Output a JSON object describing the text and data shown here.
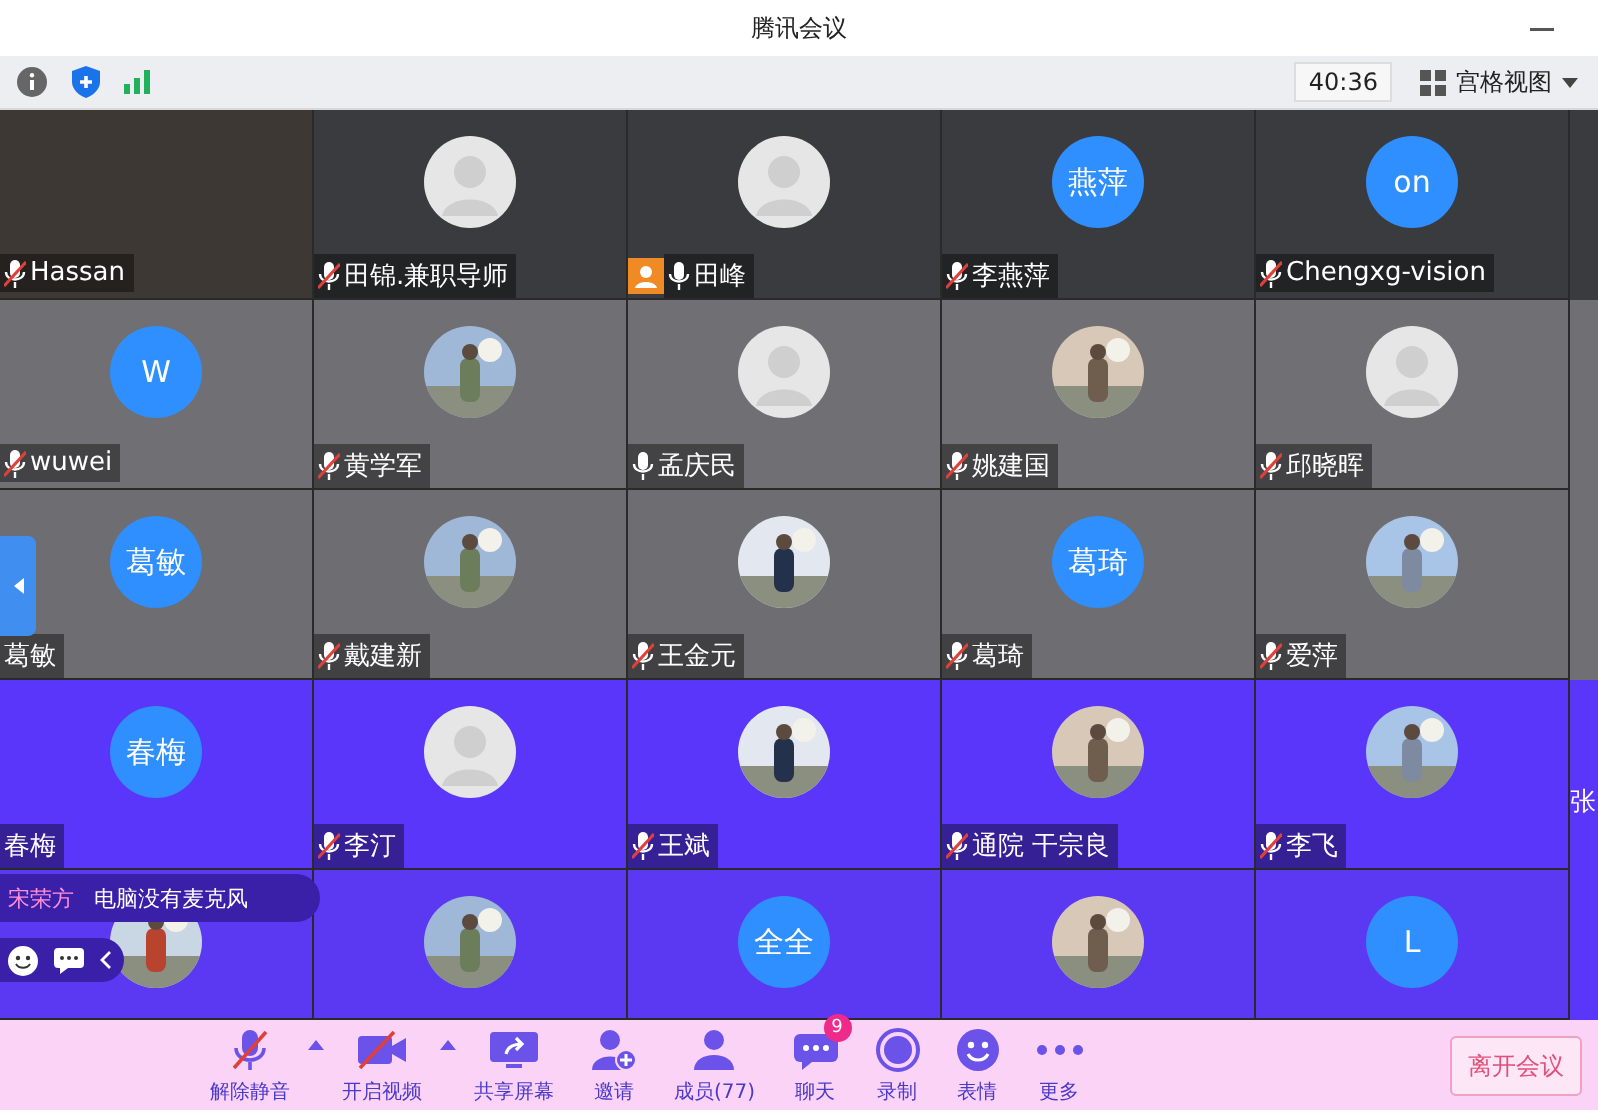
{
  "window": {
    "title": "腾讯会议"
  },
  "info_bar": {
    "timer": "40:36",
    "view_button": "宫格视图"
  },
  "tiles": [
    {
      "name": "Hassan",
      "muted": true,
      "avatar": {
        "kind": "video"
      }
    },
    {
      "name": "田锦.兼职导师",
      "muted": true,
      "avatar": {
        "kind": "silhouette"
      }
    },
    {
      "name": "田峰",
      "muted": false,
      "host": true,
      "avatar": {
        "kind": "silhouette"
      }
    },
    {
      "name": "李燕萍",
      "muted": true,
      "avatar": {
        "kind": "initials",
        "text": "燕萍"
      }
    },
    {
      "name": "Chengxg-vision",
      "muted": true,
      "avatar": {
        "kind": "initials",
        "text": "on"
      }
    },
    {
      "name": "wuwei",
      "muted": true,
      "avatar": {
        "kind": "initials",
        "text": "W"
      }
    },
    {
      "name": "黄学军",
      "muted": true,
      "avatar": {
        "kind": "picture"
      }
    },
    {
      "name": "孟庆民",
      "muted": false,
      "avatar": {
        "kind": "silhouette"
      }
    },
    {
      "name": "姚建国",
      "muted": true,
      "avatar": {
        "kind": "picture"
      }
    },
    {
      "name": "邱晓晖",
      "muted": true,
      "avatar": {
        "kind": "silhouette"
      }
    },
    {
      "name": "葛敏",
      "avatar": {
        "kind": "initials",
        "text": "葛敏"
      }
    },
    {
      "name": "戴建新",
      "muted": true,
      "avatar": {
        "kind": "picture"
      }
    },
    {
      "name": "王金元",
      "muted": true,
      "avatar": {
        "kind": "picture"
      }
    },
    {
      "name": "葛琦",
      "muted": true,
      "avatar": {
        "kind": "initials",
        "text": "葛琦"
      }
    },
    {
      "name": "爱萍",
      "muted": true,
      "avatar": {
        "kind": "picture"
      }
    },
    {
      "name": "春梅",
      "avatar": {
        "kind": "initials",
        "text": "春梅"
      }
    },
    {
      "name": "李汀",
      "muted": true,
      "avatar": {
        "kind": "silhouette"
      }
    },
    {
      "name": "王斌",
      "muted": true,
      "avatar": {
        "kind": "picture"
      }
    },
    {
      "name": "通院 干宗良",
      "muted": true,
      "avatar": {
        "kind": "picture"
      }
    },
    {
      "name": "李飞",
      "muted": true,
      "avatar": {
        "kind": "picture"
      }
    },
    {
      "avatar": {
        "kind": "picture"
      }
    },
    {
      "avatar": {
        "kind": "picture"
      }
    },
    {
      "avatar": {
        "kind": "initials",
        "text": "全全"
      }
    },
    {
      "avatar": {
        "kind": "picture"
      }
    },
    {
      "avatar": {
        "kind": "initials",
        "text": "L"
      }
    }
  ],
  "edge_tile": {
    "name": "张"
  },
  "chat_popup": {
    "sender": "宋荣方",
    "message": "电脑没有麦克风"
  },
  "controls": [
    {
      "kind": "mic-off",
      "label": "解除静音",
      "menu": true
    },
    {
      "kind": "video-off",
      "label": "开启视频",
      "menu": true
    },
    {
      "kind": "share",
      "label": "共享屏幕",
      "menu": false
    },
    {
      "kind": "invite",
      "label": "邀请",
      "menu": false
    },
    {
      "kind": "members",
      "label": "成员(77)",
      "menu": false
    },
    {
      "kind": "chat",
      "label": "聊天",
      "menu": false,
      "badge": "9"
    },
    {
      "kind": "record",
      "label": "录制",
      "menu": false
    },
    {
      "kind": "emoji",
      "label": "表情",
      "menu": false
    },
    {
      "kind": "more",
      "label": "更多",
      "menu": false
    }
  ],
  "leave_button": "离开会议"
}
